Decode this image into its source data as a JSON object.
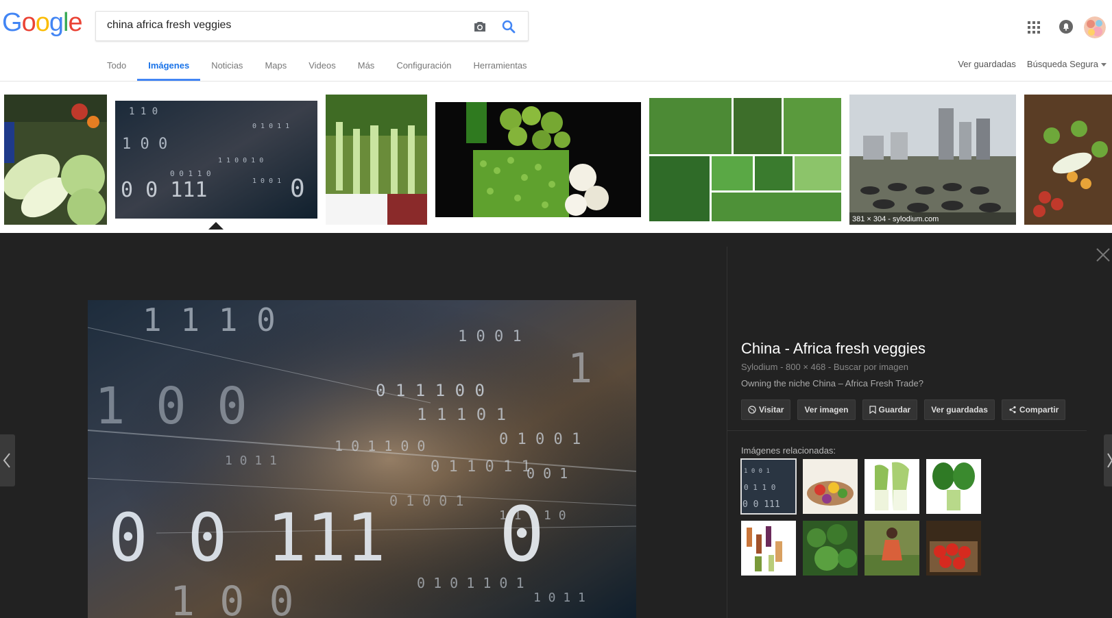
{
  "logo": {
    "letters": [
      "G",
      "o",
      "o",
      "g",
      "l",
      "e"
    ],
    "colors": [
      "#4285F4",
      "#EA4335",
      "#FBBC05",
      "#4285F4",
      "#34A853",
      "#EA4335"
    ]
  },
  "search": {
    "query": "china africa fresh veggies",
    "camera_icon": "camera-icon",
    "search_icon": "search-icon"
  },
  "tabs": [
    {
      "label": "Todo",
      "active": false
    },
    {
      "label": "Imágenes",
      "active": true
    },
    {
      "label": "Noticias",
      "active": false
    },
    {
      "label": "Maps",
      "active": false
    },
    {
      "label": "Videos",
      "active": false
    },
    {
      "label": "Más",
      "active": false
    },
    {
      "label": "Configuración",
      "active": false
    },
    {
      "label": "Herramientas",
      "active": false
    }
  ],
  "header_right": {
    "saved": "Ver guardadas",
    "safe_search": "Búsqueda Segura"
  },
  "results": {
    "thumbnail_caption": "381 × 304 - sylodium.com"
  },
  "preview": {
    "title": "China - Africa fresh veggies",
    "source": "Sylodium",
    "dimensions": "800 × 468",
    "search_by_image": "Buscar por imagen",
    "description": "Owning the niche China – Africa Fresh Trade?",
    "actions": {
      "visit": "Visitar",
      "view_image": "Ver imagen",
      "save": "Guardar",
      "view_saved": "Ver guardadas",
      "share": "Compartir"
    },
    "related_label": "Imágenes relacionadas:"
  },
  "colors": {
    "accent": "#4285f4",
    "panel_bg": "#222222"
  }
}
